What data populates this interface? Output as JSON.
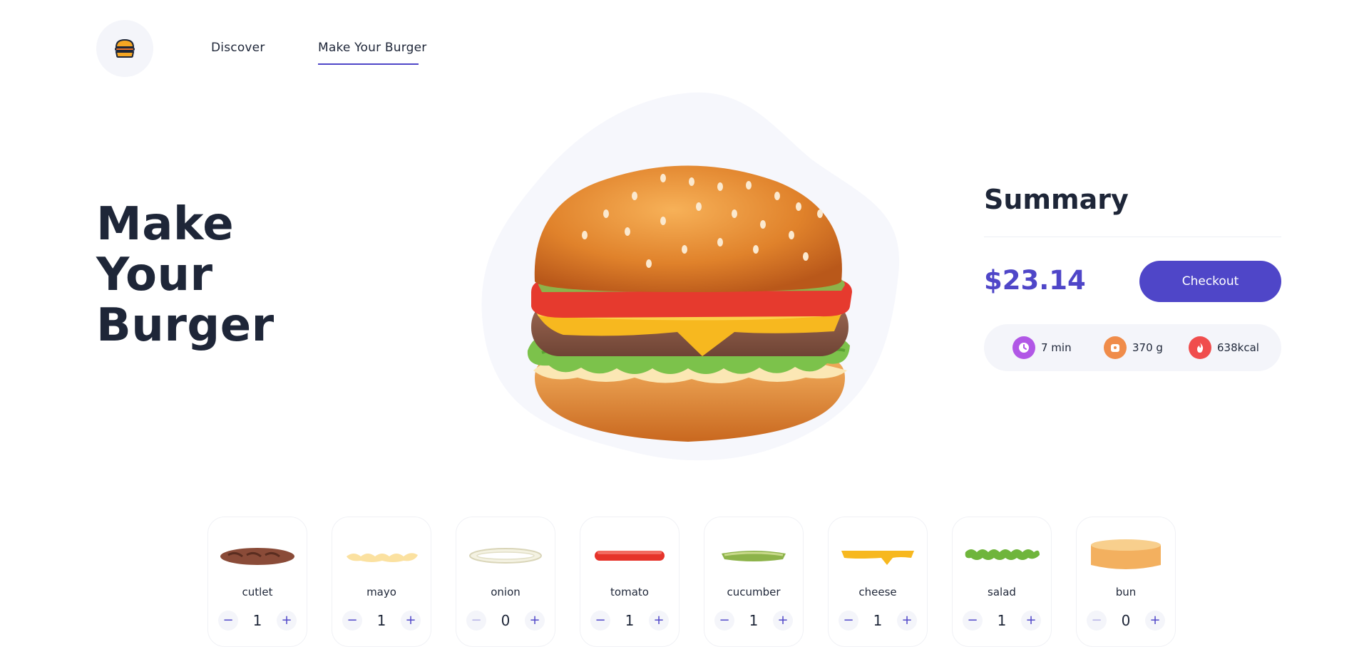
{
  "nav": {
    "logo_icon": "burger-icon",
    "links": [
      {
        "label": "Discover",
        "active": false
      },
      {
        "label": "Make Your Burger",
        "active": true
      }
    ]
  },
  "hero": {
    "title_lines": [
      "Make",
      "Your",
      "Burger"
    ]
  },
  "summary": {
    "title": "Summary",
    "price": "$23.14",
    "checkout_label": "Checkout",
    "stats": [
      {
        "icon": "clock-icon",
        "value": "7 min",
        "color": "#b157e6"
      },
      {
        "icon": "weight-icon",
        "value": "370 g",
        "color": "#f08c4a"
      },
      {
        "icon": "flame-icon",
        "value": "638kcal",
        "color": "#f04d4d"
      }
    ]
  },
  "ingredients": [
    {
      "name": "cutlet",
      "qty": "1"
    },
    {
      "name": "mayo",
      "qty": "1"
    },
    {
      "name": "onion",
      "qty": "0"
    },
    {
      "name": "tomato",
      "qty": "1"
    },
    {
      "name": "cucumber",
      "qty": "1"
    },
    {
      "name": "cheese",
      "qty": "1"
    },
    {
      "name": "salad",
      "qty": "1"
    },
    {
      "name": "bun",
      "qty": "0"
    }
  ],
  "stepper": {
    "minus": "−",
    "plus": "+"
  },
  "colors": {
    "accent": "#4f46c8",
    "text": "#1e2638",
    "soft_bg": "#f4f5fa"
  }
}
